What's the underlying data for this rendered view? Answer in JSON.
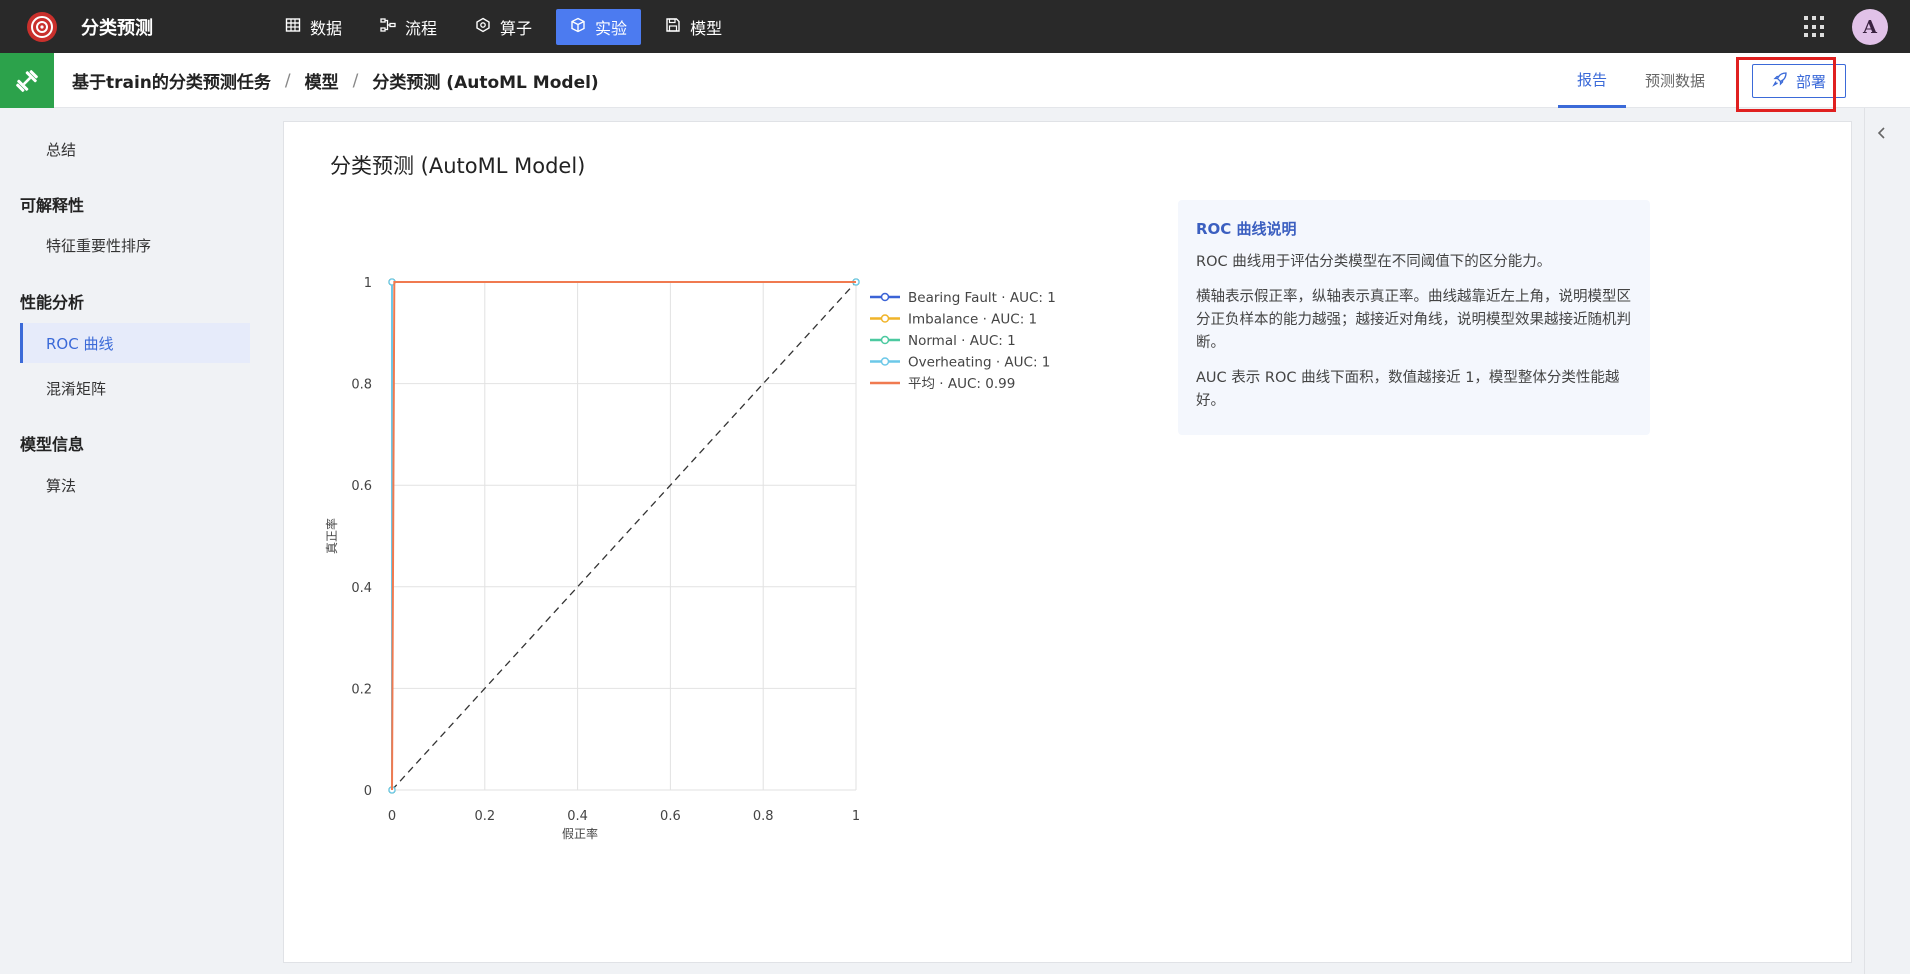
{
  "app": {
    "title": "分类预测"
  },
  "topnav": [
    {
      "label": "数据",
      "icon": "table-icon",
      "active": false
    },
    {
      "label": "流程",
      "icon": "flow-icon",
      "active": false
    },
    {
      "label": "算子",
      "icon": "hexagon-icon",
      "active": false
    },
    {
      "label": "实验",
      "icon": "cube-icon",
      "active": true
    },
    {
      "label": "模型",
      "icon": "save-icon",
      "active": false
    }
  ],
  "user": {
    "avatar_letter": "A"
  },
  "breadcrumb": [
    "基于train的分类预测任务",
    "模型",
    "分类预测 (AutoML Model)"
  ],
  "breadcrumb_sep": "/",
  "header_tabs": [
    {
      "label": "报告",
      "active": true
    },
    {
      "label": "预测数据",
      "active": false
    }
  ],
  "deploy_label": "部署",
  "sidebar": {
    "summary": "总结",
    "sections": [
      {
        "title": "可解释性",
        "items": [
          "特征重要性排序"
        ]
      },
      {
        "title": "性能分析",
        "items": [
          "ROC 曲线",
          "混淆矩阵"
        ]
      },
      {
        "title": "模型信息",
        "items": [
          "算法"
        ]
      }
    ],
    "active_item": "ROC 曲线"
  },
  "main": {
    "title": "分类预测 (AutoML Model)"
  },
  "info": {
    "title": "ROC 曲线说明",
    "p1": "ROC 曲线用于评估分类模型在不同阈值下的区分能力。",
    "p2": "横轴表示假正率，纵轴表示真正率。曲线越靠近左上角，说明模型区分正负样本的能力越强；越接近对角线，说明模型效果越接近随机判断。",
    "p3": "AUC 表示 ROC 曲线下面积，数值越接近 1，模型整体分类性能越好。"
  },
  "chart_data": {
    "type": "line",
    "xlabel": "假正率",
    "ylabel": "真正率",
    "xlim": [
      0,
      1
    ],
    "ylim": [
      0,
      1
    ],
    "xticks": [
      "0",
      "0.2",
      "0.4",
      "0.6",
      "0.8",
      "1"
    ],
    "yticks": [
      "0",
      "0.2",
      "0.4",
      "0.6",
      "0.8",
      "1"
    ],
    "grid": true,
    "legend_position": "right",
    "series": [
      {
        "name": "Bearing Fault · AUC: 1",
        "color": "#3b63d6",
        "markers": true,
        "x": [
          0,
          0,
          1
        ],
        "y": [
          0,
          1,
          1
        ]
      },
      {
        "name": "Imbalance · AUC: 1",
        "color": "#f0b429",
        "markers": true,
        "x": [
          0,
          0,
          1
        ],
        "y": [
          0,
          1,
          1
        ]
      },
      {
        "name": "Normal · AUC: 1",
        "color": "#4cc9a0",
        "markers": true,
        "x": [
          0,
          0,
          1
        ],
        "y": [
          0,
          1,
          1
        ]
      },
      {
        "name": "Overheating · AUC: 1",
        "color": "#6cc8e8",
        "markers": true,
        "x": [
          0,
          0,
          1
        ],
        "y": [
          0,
          1,
          1
        ]
      },
      {
        "name": "平均 · AUC: 0.99",
        "color": "#f07a50",
        "markers": false,
        "x": [
          0,
          0.005,
          1
        ],
        "y": [
          0,
          1,
          1
        ]
      }
    ],
    "diagonal": {
      "x": [
        0,
        1
      ],
      "y": [
        0,
        1
      ],
      "dashed": true,
      "color": "#333"
    }
  }
}
